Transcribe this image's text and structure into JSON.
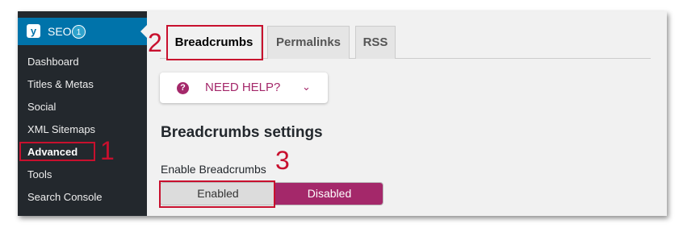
{
  "sidebar": {
    "seo": {
      "icon": "yoast-icon",
      "label": "SEO",
      "badge": "1"
    },
    "items": [
      {
        "label": "Dashboard"
      },
      {
        "label": "Titles & Metas"
      },
      {
        "label": "Social"
      },
      {
        "label": "XML Sitemaps"
      },
      {
        "label": "Advanced",
        "current": true
      },
      {
        "label": "Tools"
      },
      {
        "label": "Search Console"
      }
    ]
  },
  "tabs": [
    {
      "label": "Breadcrumbs",
      "active": true
    },
    {
      "label": "Permalinks"
    },
    {
      "label": "RSS"
    }
  ],
  "help": {
    "icon": "question-circle-icon",
    "label": "NEED HELP?",
    "chevron": "chevron-down-icon"
  },
  "section": {
    "title": "Breadcrumbs settings"
  },
  "field": {
    "label": "Enable Breadcrumbs",
    "options": [
      "Enabled",
      "Disabled"
    ],
    "selected": "Disabled"
  },
  "annotations": {
    "one": "1",
    "two": "2",
    "three": "3"
  },
  "colors": {
    "sidebar_bg": "#23282d",
    "seo_active": "#0073aa",
    "accent": "#a4286a",
    "annotation": "#c8102e"
  }
}
